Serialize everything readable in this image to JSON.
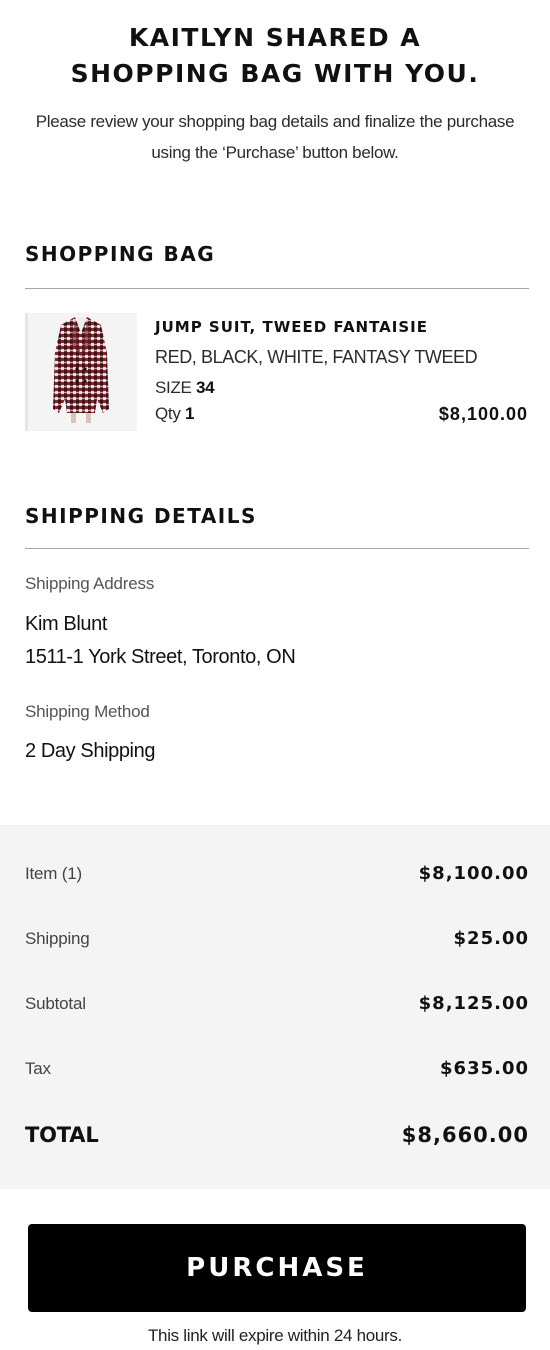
{
  "header": {
    "title_line1": "KAITLYN SHARED A",
    "title_line2": "SHOPPING BAG WITH YOU.",
    "subtitle": "Please review your shopping bag details and finalize the purchase using the ‘Purchase’ button below."
  },
  "bag": {
    "heading": "SHOPPING BAG",
    "item": {
      "image_icon": "tweed-suit-image",
      "name": "JUMP SUIT, TWEED FANTAISIE",
      "color": "RED, BLACK, WHITE, FANTASY TWEED",
      "size_label": "SIZE",
      "size_value": "34",
      "qty_label": "Qty",
      "qty_value": "1",
      "price": "$8,100.00"
    }
  },
  "shipping": {
    "heading": "SHIPPING DETAILS",
    "address_label": "Shipping Address",
    "name": "Kim Blunt",
    "address": "1511-1 York Street, Toronto, ON",
    "method_label": "Shipping Method",
    "method": "2 Day Shipping"
  },
  "summary": {
    "rows": [
      {
        "label": "Item (1)",
        "value": "$8,100.00"
      },
      {
        "label": "Shipping",
        "value": "$25.00"
      },
      {
        "label": "Subtotal",
        "value": "$8,125.00"
      },
      {
        "label": "Tax",
        "value": "$635.00"
      }
    ],
    "total_label": "TOTAL",
    "total_value": "$8,660.00"
  },
  "purchase": {
    "button_label": "PURCHASE",
    "expire_note": "This link will expire within 24 hours."
  },
  "colors": {
    "button_bg": "#000000",
    "summary_bg": "#f4f4f4",
    "rule": "#a8a8a8",
    "tweed_red": "#8b2232"
  }
}
